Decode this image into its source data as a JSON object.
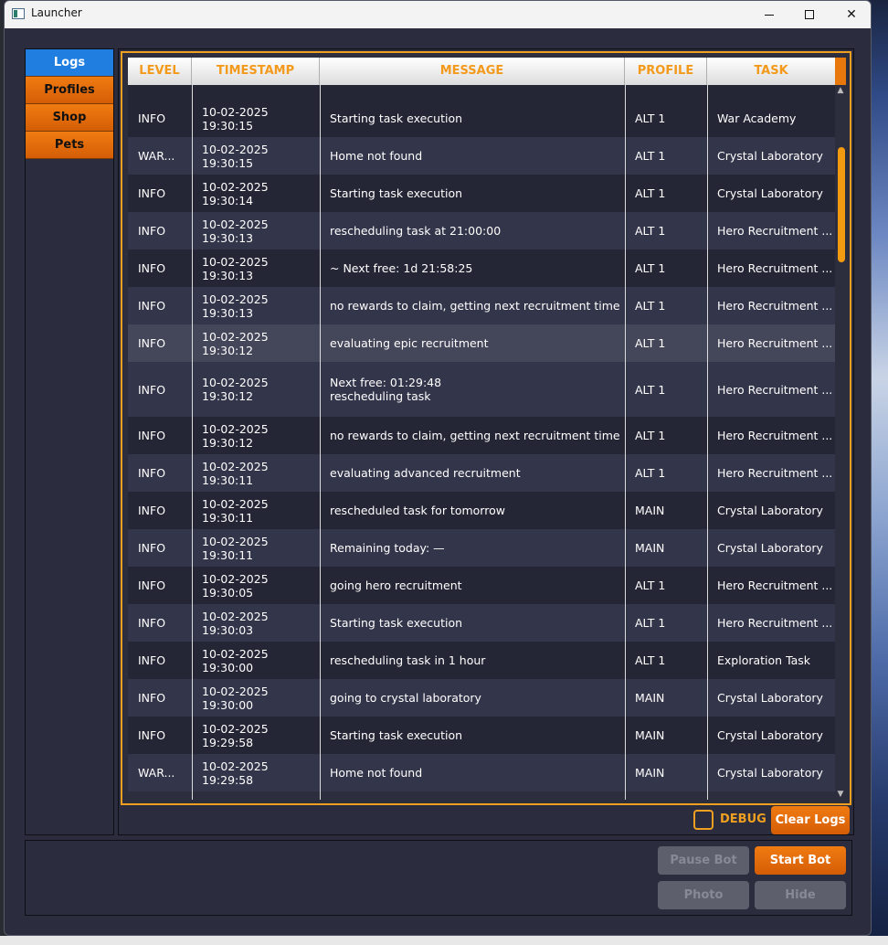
{
  "window": {
    "title": "Launcher"
  },
  "nav": {
    "items": [
      "Logs",
      "Profiles",
      "Shop",
      "Pets"
    ]
  },
  "table": {
    "columns": [
      "LEVEL",
      "TIMESTAMP",
      "MESSAGE",
      "PROFILE",
      "TASK"
    ],
    "rows": [
      {
        "level": "INFO",
        "timestamp": "10-02-2025 19:30:15",
        "message": "Starting task execution",
        "profile": "ALT 1",
        "task": "War Academy"
      },
      {
        "level": "WAR...",
        "timestamp": "10-02-2025 19:30:15",
        "message": "Home not found",
        "profile": "ALT 1",
        "task": "Crystal Laboratory"
      },
      {
        "level": "INFO",
        "timestamp": "10-02-2025 19:30:14",
        "message": "Starting task execution",
        "profile": "ALT 1",
        "task": "Crystal Laboratory"
      },
      {
        "level": "INFO",
        "timestamp": "10-02-2025 19:30:13",
        "message": "rescheduling task at 21:00:00",
        "profile": "ALT 1",
        "task": "Hero Recruitment ..."
      },
      {
        "level": "INFO",
        "timestamp": "10-02-2025 19:30:13",
        "message": "~ Next free: 1d 21:58:25",
        "profile": "ALT 1",
        "task": "Hero Recruitment ..."
      },
      {
        "level": "INFO",
        "timestamp": "10-02-2025 19:30:13",
        "message": "no rewards to claim, getting next recruitment time",
        "profile": "ALT 1",
        "task": "Hero Recruitment ..."
      },
      {
        "level": "INFO",
        "timestamp": "10-02-2025 19:30:12",
        "message": "evaluating epic recruitment",
        "profile": "ALT 1",
        "task": "Hero Recruitment ..."
      },
      {
        "level": "INFO",
        "timestamp": "10-02-2025 19:30:12",
        "message": "Next free: 01:29:48\n rescheduling task",
        "profile": "ALT 1",
        "task": "Hero Recruitment ..."
      },
      {
        "level": "INFO",
        "timestamp": "10-02-2025 19:30:12",
        "message": "no rewards to claim, getting next recruitment time",
        "profile": "ALT 1",
        "task": "Hero Recruitment ..."
      },
      {
        "level": "INFO",
        "timestamp": "10-02-2025 19:30:11",
        "message": "evaluating advanced recruitment",
        "profile": "ALT 1",
        "task": "Hero Recruitment ..."
      },
      {
        "level": "INFO",
        "timestamp": "10-02-2025 19:30:11",
        "message": "rescheduled task for tomorrow",
        "profile": "MAIN",
        "task": "Crystal Laboratory"
      },
      {
        "level": "INFO",
        "timestamp": "10-02-2025 19:30:11",
        "message": "Remaining today: —",
        "profile": "MAIN",
        "task": "Crystal Laboratory"
      },
      {
        "level": "INFO",
        "timestamp": "10-02-2025 19:30:05",
        "message": "going hero recruitment",
        "profile": "ALT 1",
        "task": "Hero Recruitment ..."
      },
      {
        "level": "INFO",
        "timestamp": "10-02-2025 19:30:03",
        "message": "Starting task execution",
        "profile": "ALT 1",
        "task": "Hero Recruitment ..."
      },
      {
        "level": "INFO",
        "timestamp": "10-02-2025 19:30:00",
        "message": "rescheduling task in 1 hour",
        "profile": "ALT 1",
        "task": "Exploration Task"
      },
      {
        "level": "INFO",
        "timestamp": "10-02-2025 19:30:00",
        "message": "going to crystal laboratory",
        "profile": "MAIN",
        "task": "Crystal Laboratory"
      },
      {
        "level": "INFO",
        "timestamp": "10-02-2025 19:29:58",
        "message": "Starting task execution",
        "profile": "MAIN",
        "task": "Crystal Laboratory"
      },
      {
        "level": "WAR...",
        "timestamp": "10-02-2025 19:29:58",
        "message": "Home not found",
        "profile": "MAIN",
        "task": "Crystal Laboratory"
      }
    ]
  },
  "controls": {
    "debug_label": "DEBUG",
    "clear_logs": "Clear Logs",
    "pause_bot": "Pause Bot",
    "start_bot": "Start Bot",
    "photo": "Photo",
    "hide": "Hide"
  },
  "colors": {
    "accent": "#f0a020",
    "button": "#e06a08",
    "active_tab": "#1f7ee0"
  }
}
